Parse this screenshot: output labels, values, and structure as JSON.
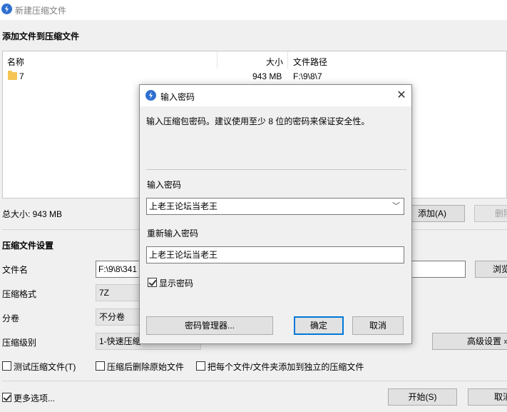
{
  "window": {
    "title": "新建压缩文件"
  },
  "files_section": {
    "title": "添加文件到压缩文件",
    "columns": {
      "name": "名称",
      "size": "大小",
      "path": "文件路径"
    },
    "rows": [
      {
        "name": "7",
        "size": "943 MB",
        "path": "F:\\9\\8\\7",
        "icon": "folder-icon"
      }
    ],
    "total_size": "总大小: 943 MB",
    "add_button": "添加(A)",
    "delete_button": "删除"
  },
  "settings_section": {
    "title": "压缩文件设置",
    "filename_label": "文件名",
    "filename_value": "F:\\9\\8\\341",
    "browse_button": "浏览",
    "format_label": "压缩格式",
    "format_value": "7Z",
    "split_label": "分卷",
    "split_value": "不分卷",
    "level_label": "压缩级别",
    "level_value": "1-快速压缩",
    "advanced_button": "高级设置 »",
    "test_option": "测试压缩文件(T)",
    "delete_after_option": "压缩后删除原始文件",
    "separate_option": "把每个文件/文件夹添加到独立的压缩文件"
  },
  "footer": {
    "more_options": "更多选项...",
    "start_button": "开始(S)",
    "cancel_button": "取消"
  },
  "password_dialog": {
    "title": "输入密码",
    "description": "输入压缩包密码。建议使用至少 8 位的密码来保证安全性。",
    "password_label": "输入密码",
    "password_value": "上老王论坛当老王",
    "reenter_label": "重新输入密码",
    "reenter_value": "上老王论坛当老王",
    "show_password": "显示密码",
    "show_password_checked": true,
    "manager_button": "密码管理器...",
    "ok_button": "确定",
    "cancel_button": "取消"
  },
  "colors": {
    "accent": "#0078d7",
    "icon_blue": "#2f6fd0",
    "folder": "#f4c553"
  }
}
